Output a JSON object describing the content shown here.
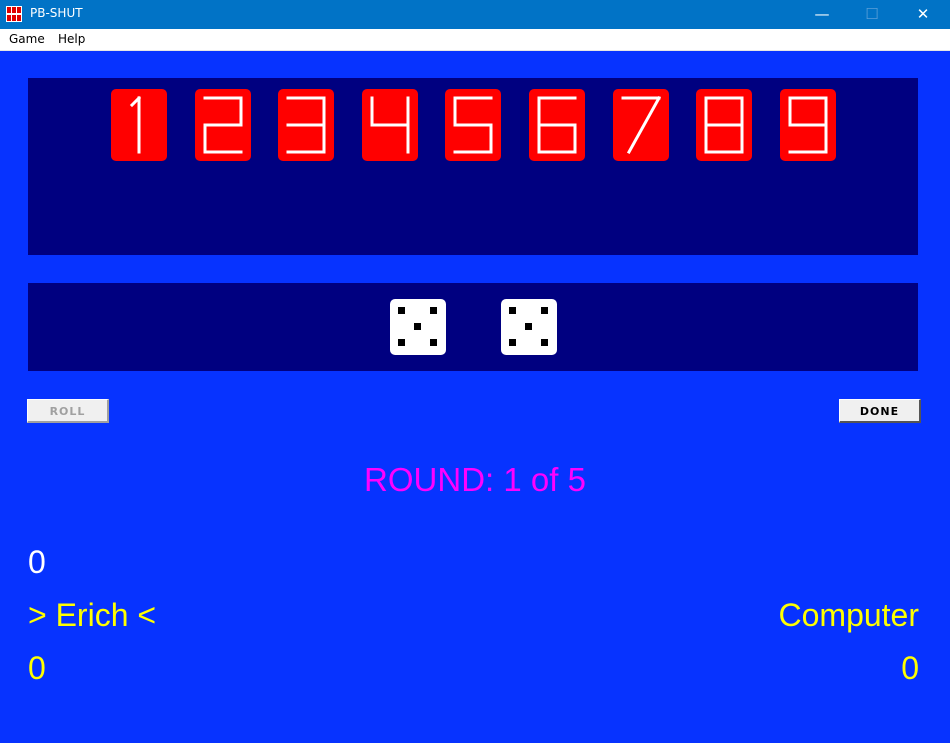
{
  "window": {
    "title": "PB-SHUT",
    "minimize_glyph": "—",
    "maximize_glyph": "☐",
    "close_glyph": "✕"
  },
  "menu": [
    "Game",
    "Help"
  ],
  "tiles": [
    {
      "digit": "1",
      "shut": false
    },
    {
      "digit": "2",
      "shut": false
    },
    {
      "digit": "3",
      "shut": false
    },
    {
      "digit": "4",
      "shut": false
    },
    {
      "digit": "5",
      "shut": false
    },
    {
      "digit": "6",
      "shut": false
    },
    {
      "digit": "7",
      "shut": false
    },
    {
      "digit": "8",
      "shut": false
    },
    {
      "digit": "9",
      "shut": false
    }
  ],
  "dice": [
    5,
    5
  ],
  "buttons": {
    "roll": "ROLL",
    "done": "DONE"
  },
  "round_label": "ROUND: 1 of 5",
  "current_turn_total": "0",
  "players": {
    "left": {
      "name": "> Erich <",
      "score": "0"
    },
    "right": {
      "name": "Computer",
      "score": "0"
    }
  },
  "colors": {
    "background": "#0733ff",
    "panel": "#000080",
    "tile": "#ff0000",
    "round_text": "#ff00ff",
    "player_text": "#ffff00",
    "turn_total_text": "#ffffff"
  }
}
